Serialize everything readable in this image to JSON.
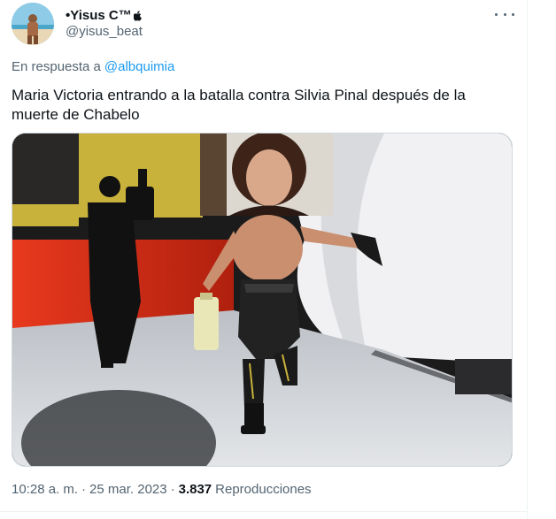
{
  "tweet": {
    "author": {
      "display_name": "•Yisus C™",
      "badge_icon": "apple-icon",
      "handle": "@yisus_beat"
    },
    "reply_prefix": "En respuesta a",
    "reply_mention": "@albquimia",
    "text": "Maria Victoria entrando a la batalla contra Silvia Pinal después de la muerte de Chabelo",
    "time": "10:28 a. m.",
    "date": "25 mar. 2023",
    "separator": "·",
    "views_count": "3.837",
    "views_label": "Reproducciones"
  },
  "colors": {
    "text_primary": "#0f1419",
    "text_secondary": "#536471",
    "link": "#1d9bf0",
    "border": "#cfd9de"
  }
}
